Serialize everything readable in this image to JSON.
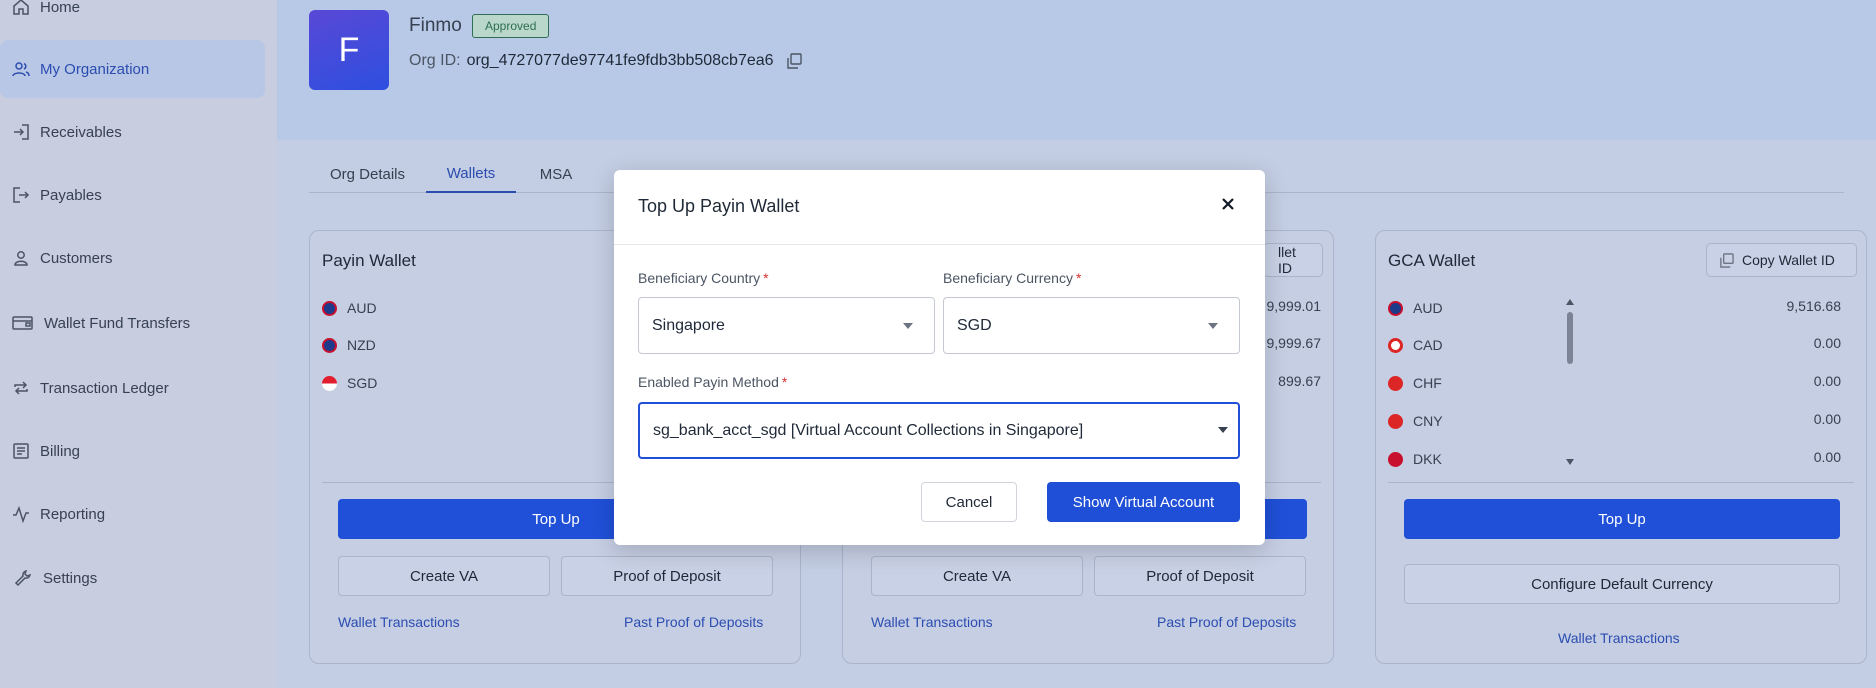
{
  "sidebar": {
    "items": [
      {
        "label": "Home",
        "icon": "home-icon"
      },
      {
        "label": "My Organization",
        "icon": "users-icon"
      },
      {
        "label": "Receivables",
        "icon": "login-icon"
      },
      {
        "label": "Payables",
        "icon": "logout-icon"
      },
      {
        "label": "Customers",
        "icon": "user-icon"
      },
      {
        "label": "Wallet Fund Transfers",
        "icon": "wallet-icon"
      },
      {
        "label": "Transaction Ledger",
        "icon": "repeat-icon"
      },
      {
        "label": "Billing",
        "icon": "list-icon"
      },
      {
        "label": "Reporting",
        "icon": "activity-icon"
      },
      {
        "label": "Settings",
        "icon": "wrench-icon"
      }
    ]
  },
  "org": {
    "logo_letter": "F",
    "name": "Finmo",
    "status": "Approved",
    "id_label": "Org ID:",
    "id_value": "org_4727077de97741fe9fdb3bb508cb7ea6"
  },
  "tabs": [
    "Org Details",
    "Wallets",
    "MSA"
  ],
  "payin_wallet": {
    "title": "Payin Wallet",
    "currencies": [
      "AUD",
      "NZD",
      "SGD"
    ],
    "top_up": "Top Up",
    "create_va": "Create VA",
    "proof": "Proof of Deposit",
    "transactions": "Wallet Transactions",
    "past_proofs": "Past Proof of Deposits"
  },
  "middle_wallet": {
    "copy_label": "llet ID",
    "amounts": [
      "9,999.01",
      "9,999.67",
      "899.67"
    ],
    "create_va": "Create VA",
    "proof": "Proof of Deposit",
    "transactions": "Wallet Transactions",
    "past_proofs": "Past Proof of Deposits"
  },
  "gca_wallet": {
    "title": "GCA Wallet",
    "copy_label": "Copy Wallet ID",
    "currencies": [
      {
        "code": "AUD",
        "amount": "9,516.68"
      },
      {
        "code": "CAD",
        "amount": "0.00"
      },
      {
        "code": "CHF",
        "amount": "0.00"
      },
      {
        "code": "CNY",
        "amount": "0.00"
      },
      {
        "code": "DKK",
        "amount": "0.00"
      }
    ],
    "top_up": "Top Up",
    "configure": "Configure Default Currency",
    "transactions": "Wallet Transactions"
  },
  "modal": {
    "title": "Top Up Payin Wallet",
    "country_label": "Beneficiary Country",
    "country_value": "Singapore",
    "currency_label": "Beneficiary Currency",
    "currency_value": "SGD",
    "method_label": "Enabled Payin Method",
    "method_value": "sg_bank_acct_sgd [Virtual Account Collections in Singapore]",
    "required_mark": "*",
    "cancel": "Cancel",
    "submit": "Show Virtual Account"
  },
  "colors": {
    "accent": "#2050d8",
    "approved": "#2f6e54",
    "required": "#d32f2f"
  }
}
